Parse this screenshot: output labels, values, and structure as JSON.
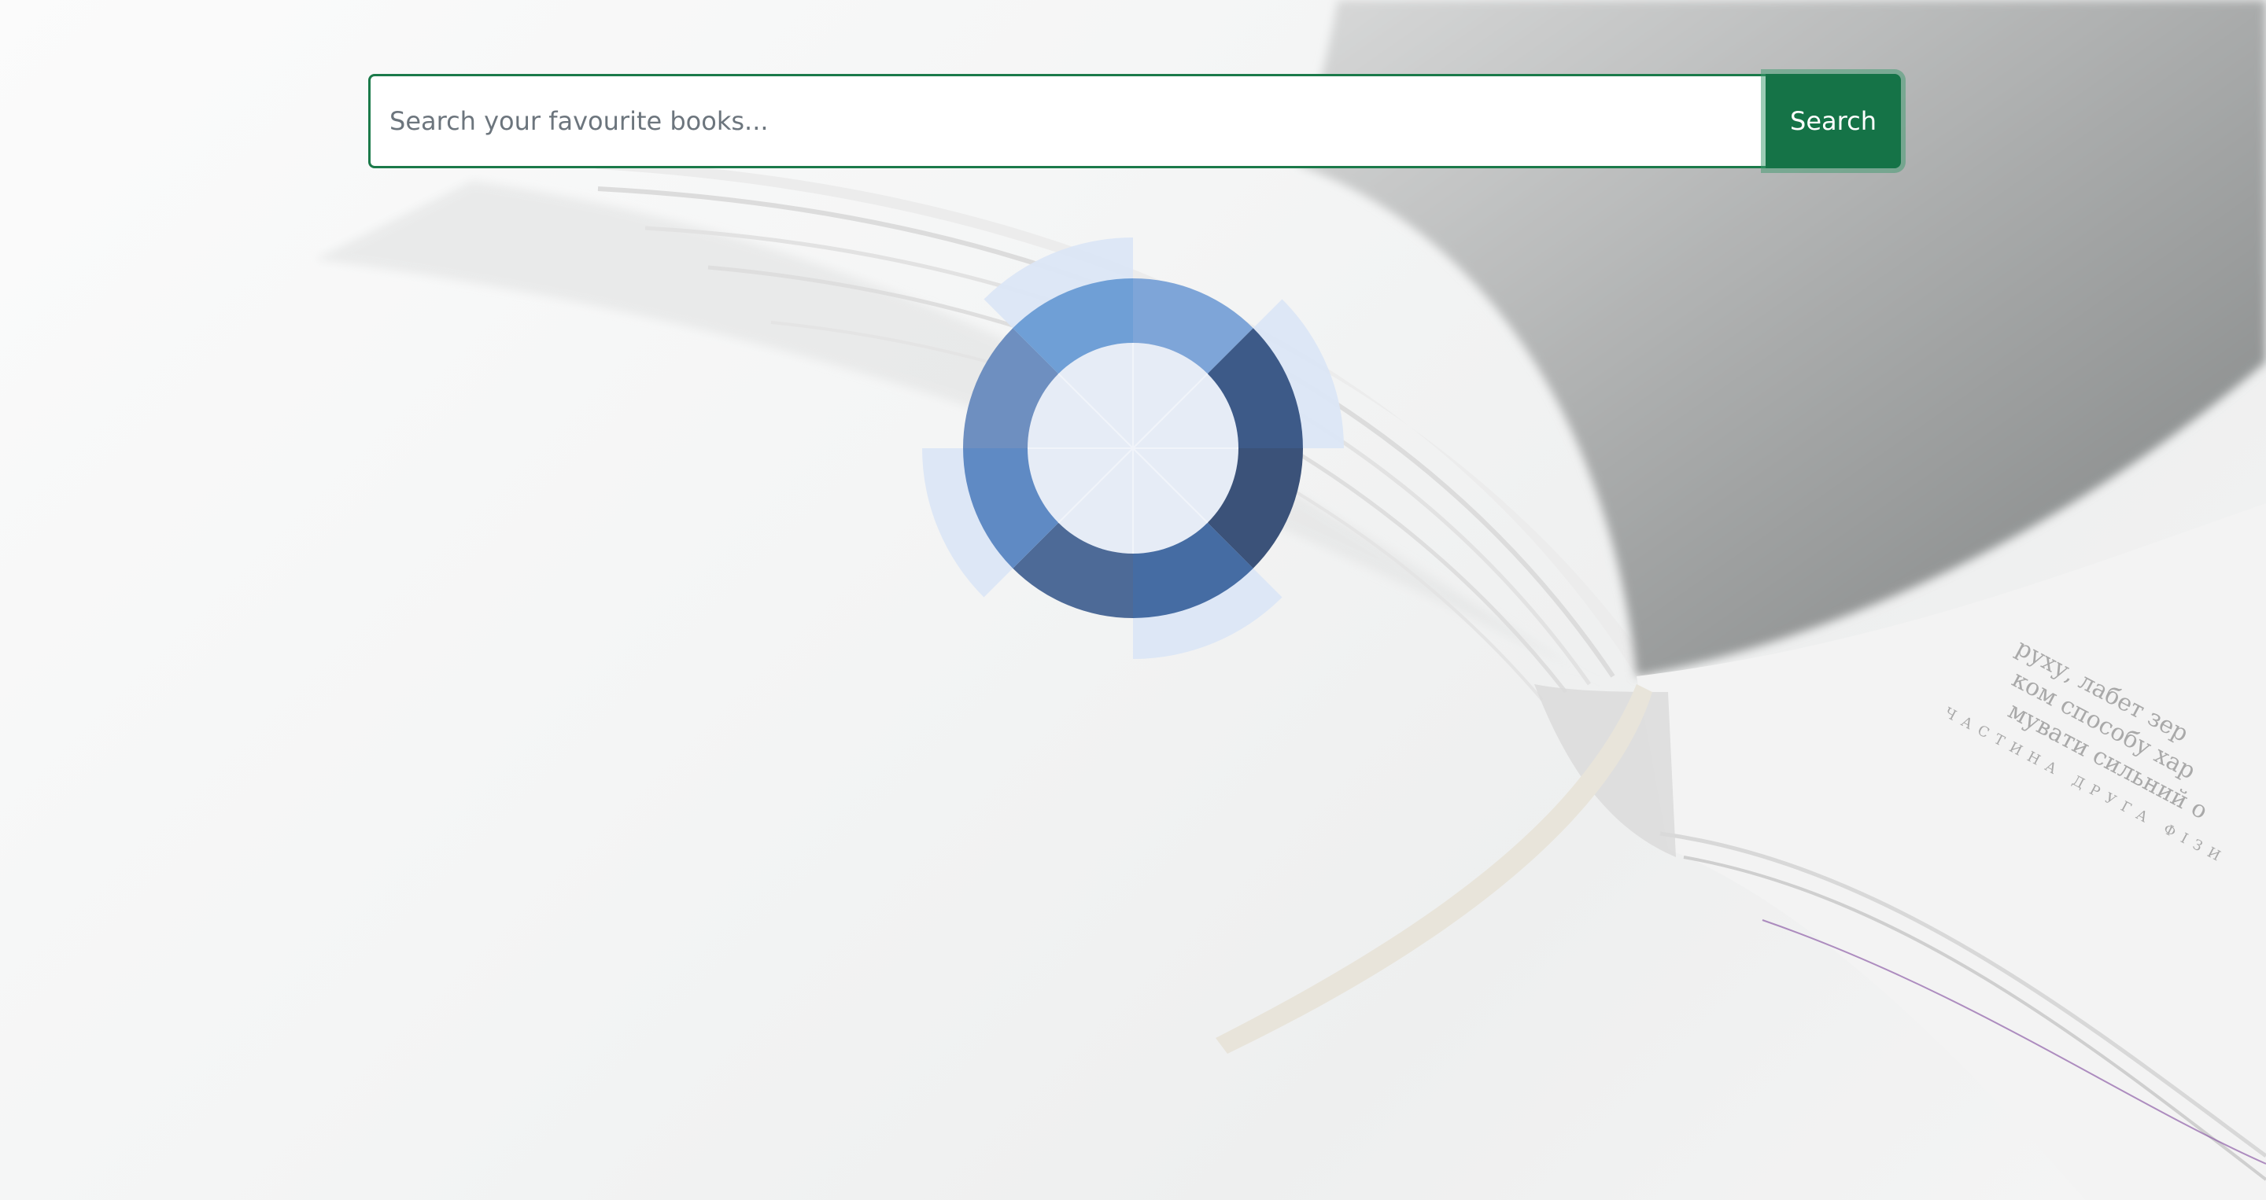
{
  "search": {
    "placeholder": "Search your favourite books...",
    "value": "",
    "button_label": "Search"
  },
  "colors": {
    "accent": "#157347",
    "input_border": "#1b7a4a",
    "loader_light": "#dbe6f5",
    "loader_mid": "#6f9fd6",
    "loader_dark": "#3b5a86"
  },
  "icons": {
    "loader": "loading-spinner-icon",
    "background": "open-book-background"
  },
  "background_page_text": [
    "руху, лабет зер",
    "ком способу хар",
    "мувати сильний о",
    "ЧАСТИНА ДРУГА  ФІЗИ"
  ]
}
